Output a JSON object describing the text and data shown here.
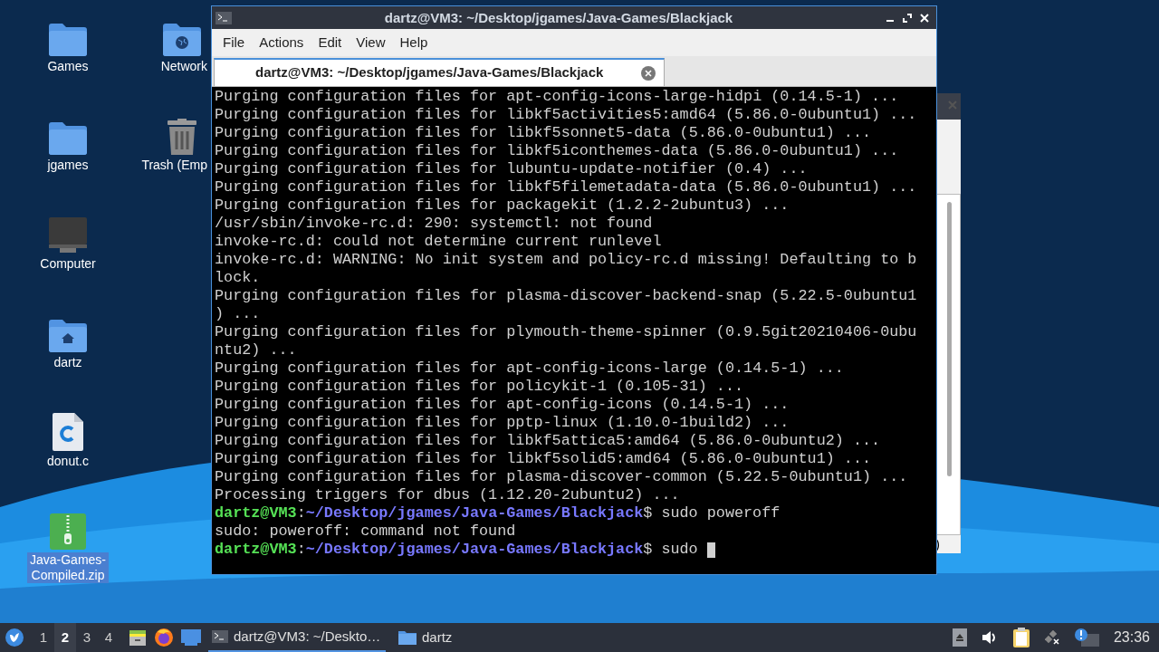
{
  "desktop_icons": [
    {
      "label": "Games",
      "kind": "folder",
      "selected": false
    },
    {
      "label": "Network",
      "kind": "network",
      "selected": false
    },
    {
      "label": "jgames",
      "kind": "folder",
      "selected": false
    },
    {
      "label": "Trash (Emp",
      "kind": "trash",
      "selected": false
    },
    {
      "label": "Computer",
      "kind": "computer",
      "selected": false
    },
    {
      "label": "dartz",
      "kind": "home",
      "selected": false
    },
    {
      "label": "donut.c",
      "kind": "cfile",
      "selected": false
    },
    {
      "label": "Java-Games-Compiled.zip",
      "kind": "zip",
      "selected": true
    }
  ],
  "back_window": {
    "text_fragment": ")"
  },
  "terminal": {
    "title": "dartz@VM3: ~/Desktop/jgames/Java-Games/Blackjack",
    "menu": [
      "File",
      "Actions",
      "Edit",
      "View",
      "Help"
    ],
    "tabs": [
      {
        "label": "dartz@VM3: ~/Desktop/jgames/Java-Games/Blackjack",
        "selected": true
      }
    ],
    "lines": [
      {
        "kind": "output",
        "text": "Purging configuration files for apt-config-icons-large-hidpi (0.14.5-1) ..."
      },
      {
        "kind": "output",
        "text": "Purging configuration files for libkf5activities5:amd64 (5.86.0-0ubuntu1) ..."
      },
      {
        "kind": "output",
        "text": "Purging configuration files for libkf5sonnet5-data (5.86.0-0ubuntu1) ..."
      },
      {
        "kind": "output",
        "text": "Purging configuration files for libkf5iconthemes-data (5.86.0-0ubuntu1) ..."
      },
      {
        "kind": "output",
        "text": "Purging configuration files for lubuntu-update-notifier (0.4) ..."
      },
      {
        "kind": "output",
        "text": "Purging configuration files for libkf5filemetadata-data (5.86.0-0ubuntu1) ..."
      },
      {
        "kind": "output",
        "text": "Purging configuration files for packagekit (1.2.2-2ubuntu3) ..."
      },
      {
        "kind": "output",
        "text": "/usr/sbin/invoke-rc.d: 290: systemctl: not found"
      },
      {
        "kind": "output",
        "text": "invoke-rc.d: could not determine current runlevel"
      },
      {
        "kind": "output",
        "text": "invoke-rc.d: WARNING: No init system and policy-rc.d missing! Defaulting to b"
      },
      {
        "kind": "output",
        "text": "lock."
      },
      {
        "kind": "output",
        "text": "Purging configuration files for plasma-discover-backend-snap (5.22.5-0ubuntu1"
      },
      {
        "kind": "output",
        "text": ") ..."
      },
      {
        "kind": "output",
        "text": "Purging configuration files for plymouth-theme-spinner (0.9.5git20210406-0ubu"
      },
      {
        "kind": "output",
        "text": "ntu2) ..."
      },
      {
        "kind": "output",
        "text": "Purging configuration files for apt-config-icons-large (0.14.5-1) ..."
      },
      {
        "kind": "output",
        "text": "Purging configuration files for policykit-1 (0.105-31) ..."
      },
      {
        "kind": "output",
        "text": "Purging configuration files for apt-config-icons (0.14.5-1) ..."
      },
      {
        "kind": "output",
        "text": "Purging configuration files for pptp-linux (1.10.0-1build2) ..."
      },
      {
        "kind": "output",
        "text": "Purging configuration files for libkf5attica5:amd64 (5.86.0-0ubuntu2) ..."
      },
      {
        "kind": "output",
        "text": "Purging configuration files for libkf5solid5:amd64 (5.86.0-0ubuntu1) ..."
      },
      {
        "kind": "output",
        "text": "Purging configuration files for plasma-discover-common (5.22.5-0ubuntu1) ..."
      },
      {
        "kind": "output",
        "text": "Processing triggers for dbus (1.12.20-2ubuntu2) ..."
      },
      {
        "kind": "prompt",
        "user_host": "dartz@VM3",
        "separator": ":",
        "path": "~/Desktop/jgames/Java-Games/Blackjack",
        "symbol": "$",
        "command": "sudo poweroff",
        "cursor": false
      },
      {
        "kind": "output",
        "text": "sudo: poweroff: command not found"
      },
      {
        "kind": "prompt",
        "user_host": "dartz@VM3",
        "separator": ":",
        "path": "~/Desktop/jgames/Java-Games/Blackjack",
        "symbol": "$",
        "command": "sudo",
        "cursor": true
      }
    ]
  },
  "taskbar": {
    "workspaces": [
      {
        "label": "1",
        "selected": false
      },
      {
        "label": "2",
        "selected": true
      },
      {
        "label": "3",
        "selected": false
      },
      {
        "label": "4",
        "selected": false
      }
    ],
    "tasks": [
      {
        "label": "dartz@VM3: ~/Deskto…",
        "kind": "terminal",
        "selected": true
      },
      {
        "label": "dartz",
        "kind": "folder",
        "selected": false
      }
    ],
    "clock": "23:36"
  }
}
